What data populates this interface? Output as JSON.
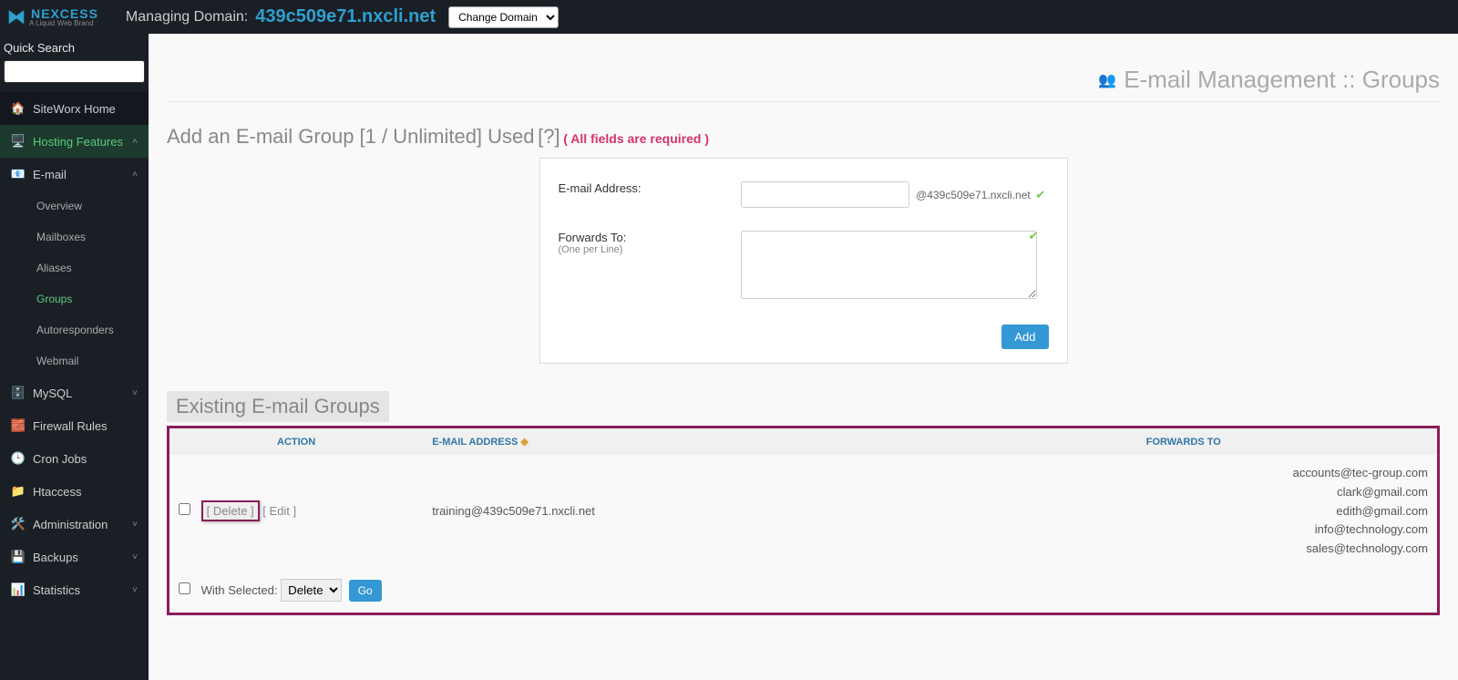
{
  "brand": {
    "name": "NEXCESS",
    "tagline": "A Liquid Web Brand"
  },
  "header": {
    "managing_label": "Managing Domain:",
    "domain": "439c509e71.nxcli.net",
    "change_domain": "Change Domain"
  },
  "sidebar": {
    "quick_search_label": "Quick Search",
    "items": {
      "home": "SiteWorx Home",
      "hosting": "Hosting Features",
      "email": "E-mail",
      "overview": "Overview",
      "mailboxes": "Mailboxes",
      "aliases": "Aliases",
      "groups": "Groups",
      "autoresponders": "Autoresponders",
      "webmail": "Webmail",
      "mysql": "MySQL",
      "firewall": "Firewall Rules",
      "cron": "Cron Jobs",
      "htaccess": "Htaccess",
      "admin": "Administration",
      "backups": "Backups",
      "stats": "Statistics"
    }
  },
  "page": {
    "title": "E-mail Management :: Groups",
    "add_title": "Add an E-mail Group [1 / Unlimited] Used",
    "help": "[?]",
    "required": "( All fields are required )",
    "email_label": "E-mail Address:",
    "domain_suffix": "@439c509e71.nxcli.net",
    "forwards_label": "Forwards To:",
    "forwards_sub": "(One per Line)",
    "add_btn": "Add",
    "existing_title": "Existing E-mail Groups"
  },
  "table": {
    "headers": {
      "action": "Action",
      "email": "E-mail Address",
      "forwards": "Forwards To"
    },
    "rows": [
      {
        "delete": "[ Delete ]",
        "edit": "[ Edit ]",
        "email": "training@439c509e71.nxcli.net",
        "forwards": [
          "accounts@tec-group.com",
          "clark@gmail.com",
          "edith@gmail.com",
          "info@technology.com",
          "sales@technology.com"
        ]
      }
    ],
    "bulk": {
      "label": "With Selected:",
      "option": "Delete",
      "go": "Go"
    }
  }
}
